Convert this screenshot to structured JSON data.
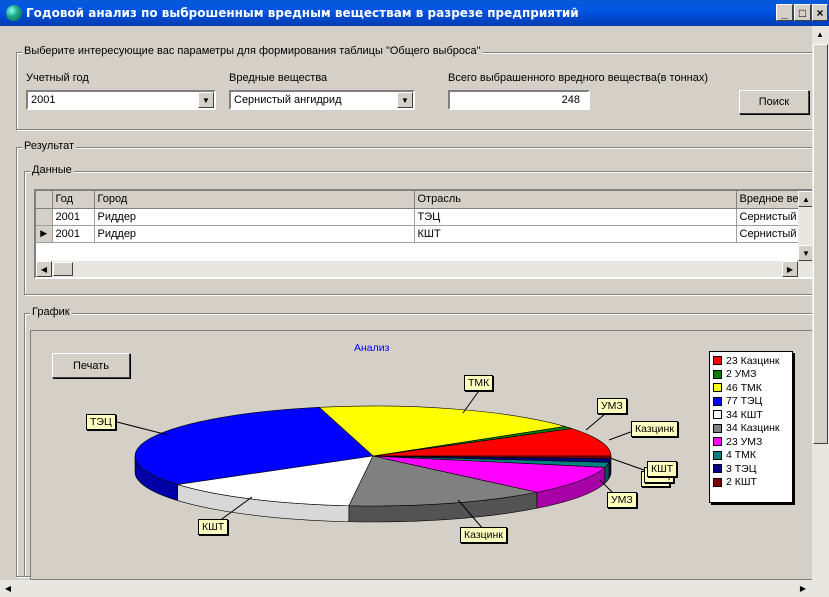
{
  "window": {
    "title": "Годовой анализ по выброшенным вредным веществам в разрезе предприятий",
    "min_label": "_",
    "max_label": "□",
    "close_label": "×"
  },
  "params": {
    "group_label": "Выберите интересующие вас параметры для формирования таблицы \"Общего выброса\"",
    "year_label": "Учетный год",
    "year_value": "2001",
    "substance_label": "Вредные вещества",
    "substance_value": "Сернистый ангидрид",
    "total_label": "Всего выбрашенного вредного вещества(в тоннах)",
    "total_value": "248",
    "search_button": "Поиск"
  },
  "result": {
    "group_label": "Результат",
    "data_label": "Данные",
    "columns": [
      "Год",
      "Город",
      "Отрасль",
      "Вредное ве"
    ],
    "rows": [
      {
        "year": "2001",
        "city": "Риддер",
        "branch": "ТЭЦ",
        "substance": "Сернистый"
      },
      {
        "year": "2001",
        "city": "Риддер",
        "branch": "КШТ",
        "substance": "Сернистый"
      }
    ]
  },
  "chart_section": {
    "group_label": "График",
    "print_button": "Печать"
  },
  "chart_data": {
    "type": "pie",
    "title": "Анализ",
    "slices": [
      {
        "label": "Казцинк",
        "value": 23,
        "color": "#ff0000"
      },
      {
        "label": "УМЗ",
        "value": 2,
        "color": "#008000"
      },
      {
        "label": "ТМК",
        "value": 46,
        "color": "#ffff00"
      },
      {
        "label": "ТЭЦ",
        "value": 77,
        "color": "#0000ff"
      },
      {
        "label": "КШТ",
        "value": 34,
        "color": "#ffffff"
      },
      {
        "label": "Казцинк",
        "value": 34,
        "color": "#808080"
      },
      {
        "label": "УМЗ",
        "value": 23,
        "color": "#ff00ff"
      },
      {
        "label": "ТМК",
        "value": 4,
        "color": "#008080"
      },
      {
        "label": "ТЭЦ",
        "value": 3,
        "color": "#000080"
      },
      {
        "label": "КШТ",
        "value": 2,
        "color": "#800000"
      }
    ],
    "legend": [
      "23 Казцинк",
      "2 УМЗ",
      "46 ТМК",
      "77 ТЭЦ",
      "34 КШТ",
      "34 Казцинк",
      "23 УМЗ",
      "4 ТМК",
      "3 ТЭЦ",
      "2 КШТ"
    ],
    "legend_position": "right"
  }
}
